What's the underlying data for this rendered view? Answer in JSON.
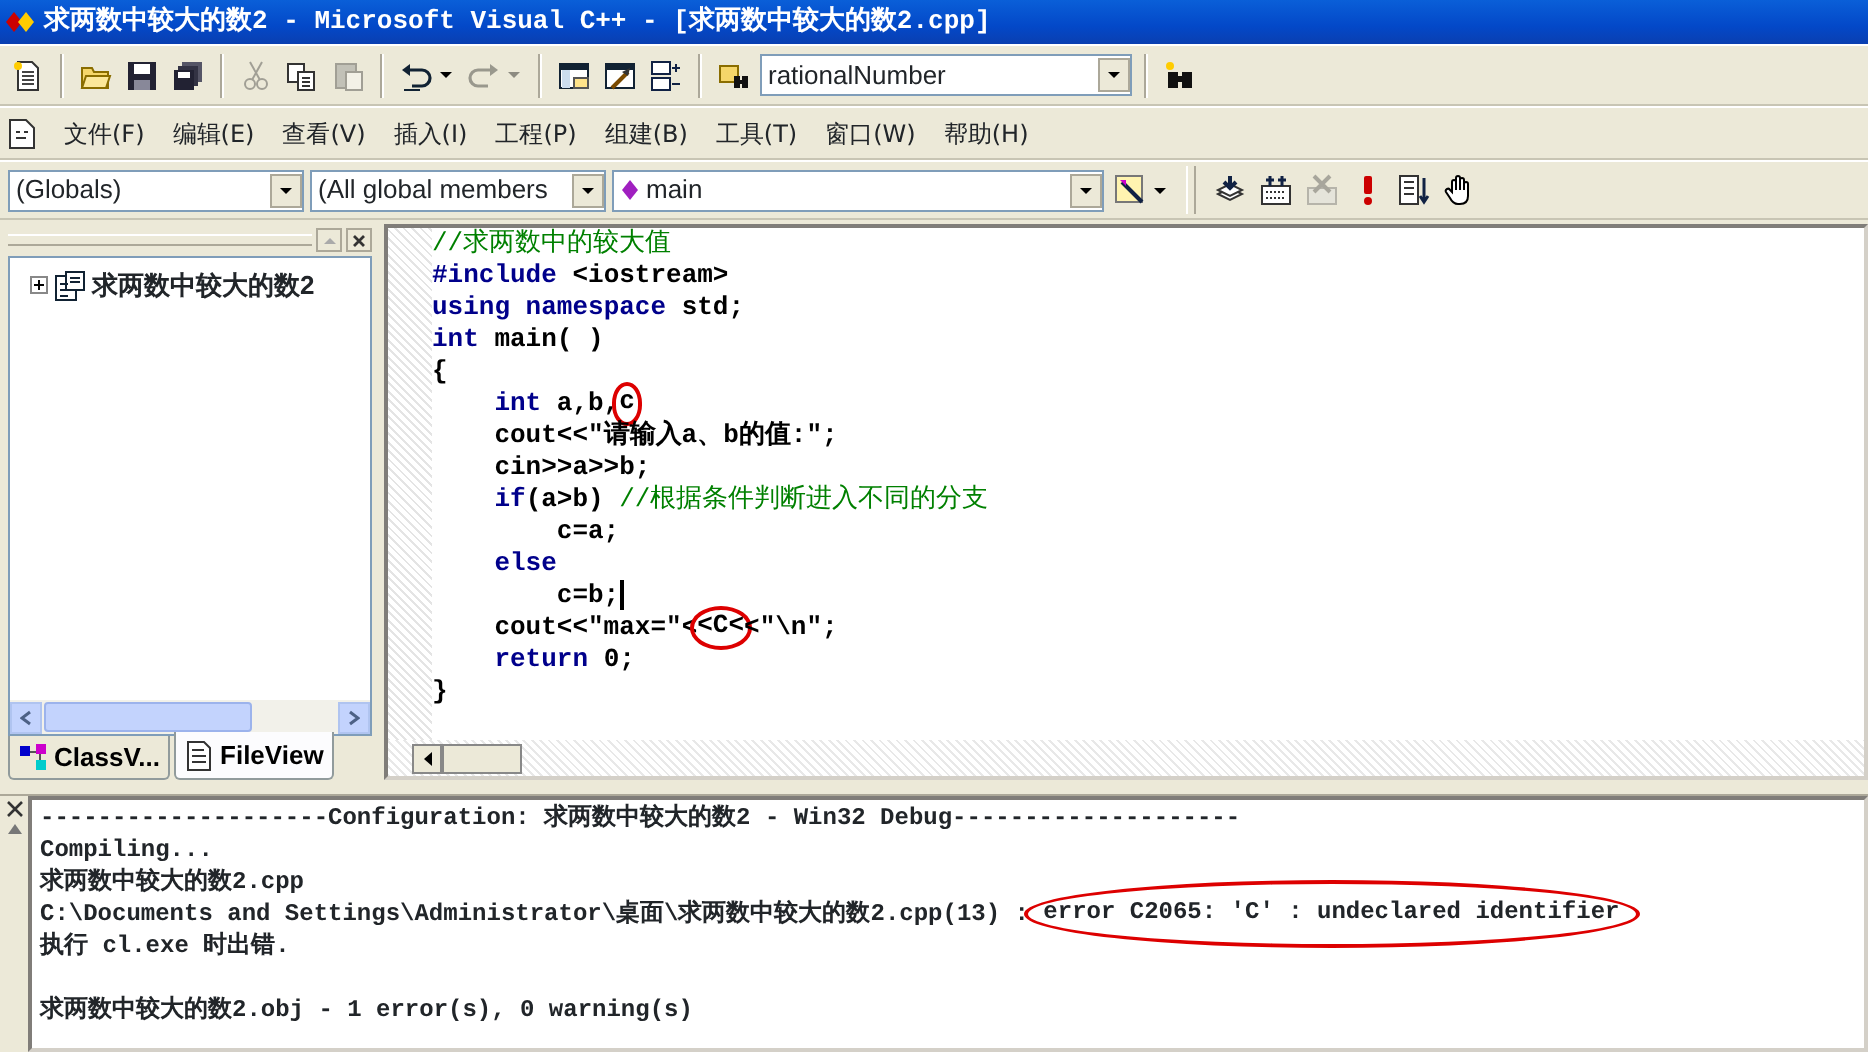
{
  "window": {
    "title": "求两数中较大的数2 - Microsoft Visual C++ - [求两数中较大的数2.cpp]"
  },
  "toolbar": {
    "items": [
      {
        "kind": "button",
        "disabled": false
      },
      {
        "kind": "separator"
      },
      {
        "kind": "button",
        "disabled": false
      },
      {
        "kind": "button",
        "disabled": false
      },
      {
        "kind": "button",
        "disabled": false
      },
      {
        "kind": "separator"
      },
      {
        "kind": "button",
        "disabled": true
      },
      {
        "kind": "button",
        "disabled": false
      },
      {
        "kind": "button",
        "disabled": true
      },
      {
        "kind": "separator"
      },
      {
        "kind": "split",
        "disabled": false
      },
      {
        "kind": "split",
        "disabled": true
      },
      {
        "kind": "separator"
      },
      {
        "kind": "button",
        "disabled": false
      },
      {
        "kind": "button",
        "disabled": false
      },
      {
        "kind": "button",
        "disabled": false
      },
      {
        "kind": "separator"
      },
      {
        "kind": "button",
        "disabled": false
      },
      {
        "kind": "combo",
        "value": "rationalNumber"
      },
      {
        "kind": "separator"
      },
      {
        "kind": "button",
        "disabled": false
      }
    ]
  },
  "menu": {
    "items": [
      "文件(F)",
      "编辑(E)",
      "查看(V)",
      "插入(I)",
      "工程(P)",
      "组建(B)",
      "工具(T)",
      "窗口(W)",
      "帮助(H)"
    ]
  },
  "wizard_bar": {
    "items": [
      {
        "kind": "combo",
        "value": "(Globals)"
      },
      {
        "kind": "combo",
        "value": "(All global members"
      },
      {
        "kind": "combo",
        "value": "main"
      },
      {
        "kind": "split",
        "disabled": false
      },
      {
        "kind": "grip"
      },
      {
        "kind": "button",
        "disabled": false
      },
      {
        "kind": "button",
        "disabled": false
      },
      {
        "kind": "button",
        "disabled": true
      },
      {
        "kind": "button",
        "disabled": false
      },
      {
        "kind": "button",
        "disabled": false
      },
      {
        "kind": "button",
        "disabled": false
      }
    ]
  },
  "workspace": {
    "tree": [
      {
        "label": "求两数中较大的数2",
        "expanded": false
      }
    ],
    "tabs": [
      {
        "label": "ClassV...",
        "selected": false
      },
      {
        "label": "FileView",
        "selected": true
      }
    ]
  },
  "editor": {
    "lines": [
      {
        "caret": false,
        "segments": [
          {
            "kind": "comment",
            "text": "//求两数中的较大值"
          }
        ]
      },
      {
        "caret": false,
        "segments": [
          {
            "kind": "keyword",
            "text": "#include"
          },
          {
            "kind": "plain",
            "text": " <iostream>"
          }
        ]
      },
      {
        "caret": false,
        "segments": [
          {
            "kind": "keyword",
            "text": "using namespace"
          },
          {
            "kind": "plain",
            "text": " std;"
          }
        ]
      },
      {
        "caret": false,
        "segments": [
          {
            "kind": "keyword",
            "text": "int"
          },
          {
            "kind": "plain",
            "text": " main( )"
          }
        ]
      },
      {
        "caret": false,
        "segments": [
          {
            "kind": "plain",
            "text": "{"
          }
        ],
        "children": [
          {
            "caret": false,
            "segments": [
              {
                "kind": "keyword",
                "text": "int"
              },
              {
                "kind": "plain",
                "text": " a,b,"
              },
              {
                "kind": "plain",
                "text": "c",
                "circled": true
              }
            ]
          },
          {
            "caret": false,
            "segments": [
              {
                "kind": "plain",
                "text": "cout<<\"请输入a、b的值:\";"
              }
            ]
          },
          {
            "caret": false,
            "segments": [
              {
                "kind": "plain",
                "text": "cin>>a>>b;"
              }
            ]
          },
          {
            "caret": false,
            "segments": [
              {
                "kind": "keyword",
                "text": "if"
              },
              {
                "kind": "plain",
                "text": "(a>b) "
              },
              {
                "kind": "comment",
                "text": "//根据条件判断进入不同的分支"
              }
            ],
            "children": [
              {
                "caret": false,
                "segments": [
                  {
                    "kind": "plain",
                    "text": "c=a;"
                  }
                ]
              }
            ]
          },
          {
            "caret": false,
            "segments": [
              {
                "kind": "keyword",
                "text": "else"
              }
            ],
            "children": [
              {
                "caret": true,
                "segments": [
                  {
                    "kind": "plain",
                    "text": "c=b;"
                  }
                ]
              }
            ]
          },
          {
            "caret": false,
            "segments": [
              {
                "kind": "plain",
                "text": "cout<<\"max=\"<"
              },
              {
                "kind": "plain",
                "text": "<C<",
                "circled": true
              },
              {
                "kind": "plain",
                "text": "<\"\\n\";"
              }
            ]
          },
          {
            "caret": false,
            "segments": [
              {
                "kind": "keyword",
                "text": "return"
              },
              {
                "kind": "plain",
                "text": " 0;"
              }
            ]
          }
        ]
      },
      {
        "caret": false,
        "segments": [
          {
            "kind": "plain",
            "text": "}"
          }
        ]
      }
    ]
  },
  "output": {
    "lines": [
      {
        "segments": [
          {
            "text": "--------------------Configuration: 求两数中较大的数2 - Win32 Debug--------------------"
          }
        ]
      },
      {
        "segments": [
          {
            "text": "Compiling..."
          }
        ]
      },
      {
        "segments": [
          {
            "text": "求两数中较大的数2.cpp"
          }
        ]
      },
      {
        "segments": [
          {
            "text": "C:\\Documents and Settings\\Administrator\\桌面\\求两数中较大的数2.cpp(13) : "
          },
          {
            "text": "error C2065: 'C' : undeclared identifier",
            "circled": true
          }
        ]
      },
      {
        "segments": [
          {
            "text": "执行 cl.exe 时出错."
          }
        ]
      }
    ],
    "summary": "求两数中较大的数2.obj - 1 error(s), 0 warning(s)"
  }
}
